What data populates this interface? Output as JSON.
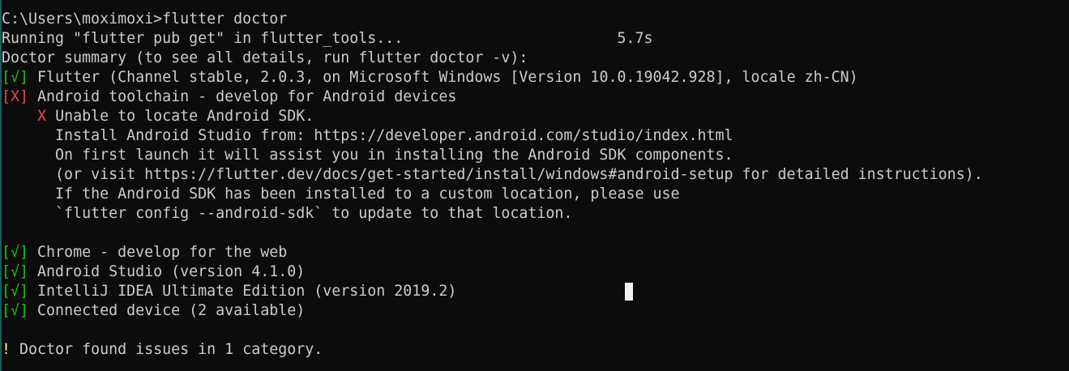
{
  "prompt": "C:\\Users\\moximoxi>",
  "command": "flutter doctor",
  "pub_get_line": "Running \"flutter pub get\" in flutter_tools...",
  "pub_get_time": "5.7s",
  "summary_line": "Doctor summary (to see all details, run flutter doctor -v):",
  "ok_mark": "[√]",
  "err_mark": "[X]",
  "checks": {
    "flutter": "Flutter (Channel stable, 2.0.3, on Microsoft Windows [Version 10.0.19042.928], locale zh-CN)",
    "android_toolchain": "Android toolchain - develop for Android devices",
    "chrome": "Chrome - develop for the web",
    "android_studio": "Android Studio (version 4.1.0)",
    "intellij": "IntelliJ IDEA Ultimate Edition (version 2019.2)",
    "connected_device": "Connected device (2 available)"
  },
  "android_error": {
    "mark": "X",
    "title": "Unable to locate Android SDK.",
    "details": [
      "Install Android Studio from: https://developer.android.com/studio/index.html",
      "On first launch it will assist you in installing the Android SDK components.",
      "(or visit https://flutter.dev/docs/get-started/install/windows#android-setup for detailed instructions).",
      "If the Android SDK has been installed to a custom location, please use",
      "`flutter config --android-sdk` to update to that location."
    ]
  },
  "issues": {
    "mark": "!",
    "text": "Doctor found issues in 1 category."
  },
  "colors": {
    "background": "#0c0c0c",
    "text": "#cccccc",
    "ok": "#16c60c",
    "error": "#e74856",
    "warning": "#f9f1a5"
  }
}
